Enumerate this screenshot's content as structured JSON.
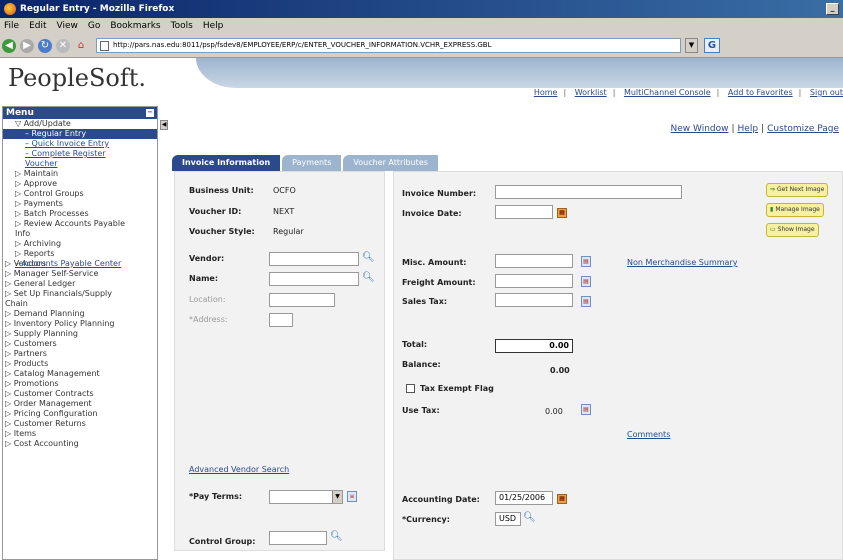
{
  "window": {
    "title": "Regular Entry - Mozilla Firefox"
  },
  "menubar": [
    "File",
    "Edit",
    "View",
    "Go",
    "Bookmarks",
    "Tools",
    "Help"
  ],
  "browser": {
    "url": "http://pars.nas.edu:8011/psp/fsdev8/EMPLOYEE/ERP/c/ENTER_VOUCHER_INFORMATION.VCHR_EXPRESS.GBL"
  },
  "header": {
    "logo": "PeopleSoft.",
    "links": [
      "Home",
      "Worklist",
      "MultiChannel Console",
      "Add to Favorites",
      "Sign out"
    ]
  },
  "menu": {
    "title": "Menu",
    "items": [
      {
        "label": "▽ Add/Update",
        "level": "l2"
      },
      {
        "label": "– Regular Entry",
        "level": "l3 active"
      },
      {
        "label": "– Quick Invoice Entry",
        "level": "l3"
      },
      {
        "label": "– Complete Register",
        "level": "l3"
      },
      {
        "label": "Voucher",
        "level": "l3"
      },
      {
        "label": "▷ Maintain",
        "level": "l2"
      },
      {
        "label": "▷ Approve",
        "level": "l2"
      },
      {
        "label": "▷ Control Groups",
        "level": "l2"
      },
      {
        "label": "▷ Payments",
        "level": "l2"
      },
      {
        "label": "▷ Batch Processes",
        "level": "l2"
      },
      {
        "label": "▷ Review Accounts Payable",
        "level": "l2"
      },
      {
        "label": "Info",
        "level": "l2"
      },
      {
        "label": "▷ Archiving",
        "level": "l2"
      },
      {
        "label": "▷ Reports",
        "level": "l2"
      },
      {
        "label": "– Accounts Payable Center",
        "level": "l2 link"
      },
      {
        "label": "▷ Vendors",
        "level": "l1"
      },
      {
        "label": "▷ Manager Self-Service",
        "level": "l1"
      },
      {
        "label": "▷ General Ledger",
        "level": "l1"
      },
      {
        "label": "▷ Set Up Financials/Supply",
        "level": "l1"
      },
      {
        "label": "Chain",
        "level": "l1"
      },
      {
        "label": "▷ Demand Planning",
        "level": "l1"
      },
      {
        "label": "▷ Inventory Policy Planning",
        "level": "l1"
      },
      {
        "label": "▷ Supply Planning",
        "level": "l1"
      },
      {
        "label": "▷ Customers",
        "level": "l1"
      },
      {
        "label": "▷ Partners",
        "level": "l1"
      },
      {
        "label": "▷ Products",
        "level": "l1"
      },
      {
        "label": "▷ Catalog Management",
        "level": "l1"
      },
      {
        "label": "▷ Promotions",
        "level": "l1"
      },
      {
        "label": "▷ Customer Contracts",
        "level": "l1"
      },
      {
        "label": "▷ Order Management",
        "level": "l1"
      },
      {
        "label": "▷ Pricing Configuration",
        "level": "l1"
      },
      {
        "label": "▷ Customer Returns",
        "level": "l1"
      },
      {
        "label": "▷ Items",
        "level": "l1"
      },
      {
        "label": "▷ Cost Accounting",
        "level": "l1"
      }
    ]
  },
  "content_links": {
    "new_window": "New Window",
    "help": "Help",
    "customize": "Customize Page"
  },
  "tabs": [
    "Invoice Information",
    "Payments",
    "Voucher Attributes"
  ],
  "form": {
    "business_unit_label": "Business Unit:",
    "business_unit": "OCFO",
    "voucher_id_label": "Voucher ID:",
    "voucher_id": "NEXT",
    "voucher_style_label": "Voucher Style:",
    "voucher_style": "Regular",
    "vendor_label": "Vendor:",
    "name_label": "Name:",
    "location_label": "Location:",
    "address_label": "*Address:",
    "adv_vendor_search": "Advanced Vendor Search",
    "pay_terms_label": "*Pay Terms:",
    "control_group_label": "Control Group:",
    "invoice_number_label": "Invoice Number:",
    "invoice_date_label": "Invoice Date:",
    "misc_amount_label": "Misc. Amount:",
    "freight_amount_label": "Freight Amount:",
    "sales_tax_label": "Sales Tax:",
    "non_merch_link": "Non Merchandise Summary",
    "total_label": "Total:",
    "total_value": "0.00",
    "balance_label": "Balance:",
    "balance_value": "0.00",
    "tax_exempt_label": "Tax Exempt Flag",
    "use_tax_label": "Use Tax:",
    "use_tax_value": "0.00",
    "comments_link": "Comments",
    "accounting_date_label": "Accounting Date:",
    "accounting_date": "01/25/2006",
    "currency_label": "*Currency:",
    "currency": "USD"
  },
  "image_buttons": [
    "Get Next Image",
    "Manage Image",
    "Show Image"
  ]
}
